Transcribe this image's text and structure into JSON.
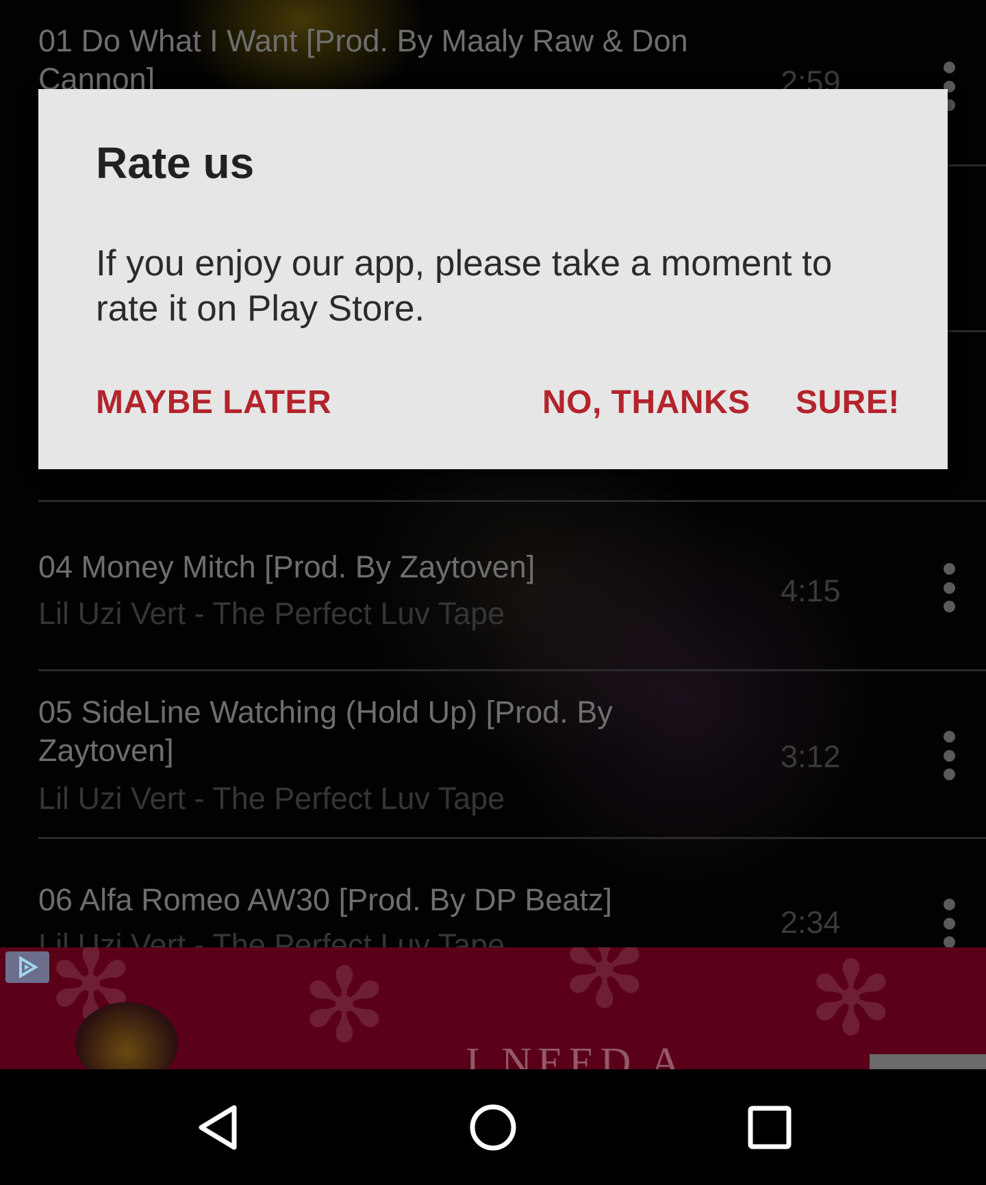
{
  "tracks": [
    {
      "title": "01 Do What I Want [Prod. By Maaly Raw & Don Cannon]",
      "duration": "2:59"
    },
    {
      "title": "04 Money Mitch [Prod. By Zaytoven]",
      "artist": "Lil Uzi Vert - The Perfect Luv Tape",
      "duration": "4:15"
    },
    {
      "title": "05 SideLine Watching (Hold Up) [Prod. By Zaytoven]",
      "artist": "Lil Uzi Vert - The Perfect Luv Tape",
      "duration": "3:12"
    },
    {
      "title": "06 Alfa Romeo AW30 [Prod. By DP Beatz]",
      "artist": "Lil Uzi Vert - The Perfect Luv Tape",
      "duration": "2:34"
    }
  ],
  "dialog": {
    "title": "Rate us",
    "message": "If you enjoy our app, please take a moment to rate it on Play Store.",
    "maybe_later": "MAYBE LATER",
    "no_thanks": "NO, THANKS",
    "sure": "SURE!"
  },
  "ad": {
    "text": "I NEED A",
    "choices_icon": "ad-choices-icon"
  },
  "nav": {
    "back_icon": "back-icon",
    "home_icon": "home-icon",
    "recents_icon": "recents-icon"
  },
  "colors": {
    "dialog_bg": "#e6e6e6",
    "accent": "#b3242c",
    "ad_bg": "#5a0018"
  }
}
